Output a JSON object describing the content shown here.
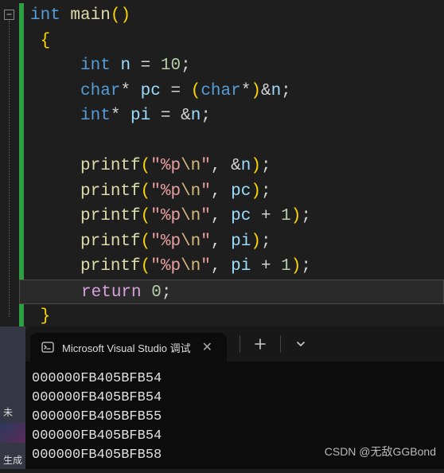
{
  "code": {
    "line1": {
      "t_int": "int",
      "t_main": "main"
    },
    "line2": {
      "brace": "{"
    },
    "line3": {
      "kw": "int",
      "var": "n",
      "eq": "=",
      "num": "10",
      "semi": ";"
    },
    "line4": {
      "kw": "char",
      "star": "*",
      "var": "pc",
      "eq": "=",
      "lp": "(",
      "cast": "char",
      "star2": "*",
      "rp": ")",
      "amp": "&",
      "var2": "n",
      "semi": ";"
    },
    "line5": {
      "kw": "int",
      "star": "*",
      "var": "pi",
      "eq": "=",
      "amp": "&",
      "var2": "n",
      "semi": ";"
    },
    "line7": {
      "fn": "printf",
      "lp": "(",
      "q1": "\"",
      "fmt": "%p",
      "esc": "\\n",
      "q2": "\"",
      "comma": ",",
      "amp": "&",
      "arg": "n",
      "rp": ")",
      "semi": ";"
    },
    "line8": {
      "fn": "printf",
      "lp": "(",
      "q1": "\"",
      "fmt": "%p",
      "esc": "\\n",
      "q2": "\"",
      "comma": ",",
      "arg": "pc",
      "rp": ")",
      "semi": ";"
    },
    "line9": {
      "fn": "printf",
      "lp": "(",
      "q1": "\"",
      "fmt": "%p",
      "esc": "\\n",
      "q2": "\"",
      "comma": ",",
      "arg": "pc",
      "plus": "+",
      "one": "1",
      "rp": ")",
      "semi": ";"
    },
    "line10": {
      "fn": "printf",
      "lp": "(",
      "q1": "\"",
      "fmt": "%p",
      "esc": "\\n",
      "q2": "\"",
      "comma": ",",
      "arg": "pi",
      "rp": ")",
      "semi": ";"
    },
    "line11": {
      "fn": "printf",
      "lp": "(",
      "q1": "\"",
      "fmt": "%p",
      "esc": "\\n",
      "q2": "\"",
      "comma": ",",
      "arg": "pi",
      "plus": "+",
      "one": "1",
      "rp": ")",
      "semi": ";"
    },
    "line12": {
      "ret": "return",
      "zero": "0",
      "semi": ";"
    },
    "line13": {
      "brace": "}"
    }
  },
  "fold": {
    "symbol": "−"
  },
  "terminal": {
    "tab_title": "Microsoft Visual Studio 调试",
    "output": [
      "000000FB405BFB54",
      "000000FB405BFB54",
      "000000FB405BFB55",
      "000000FB405BFB54",
      "000000FB405BFB58"
    ]
  },
  "strip": {
    "label1": "未",
    "label2": "生成"
  },
  "watermark": "CSDN @无敌GGBond"
}
